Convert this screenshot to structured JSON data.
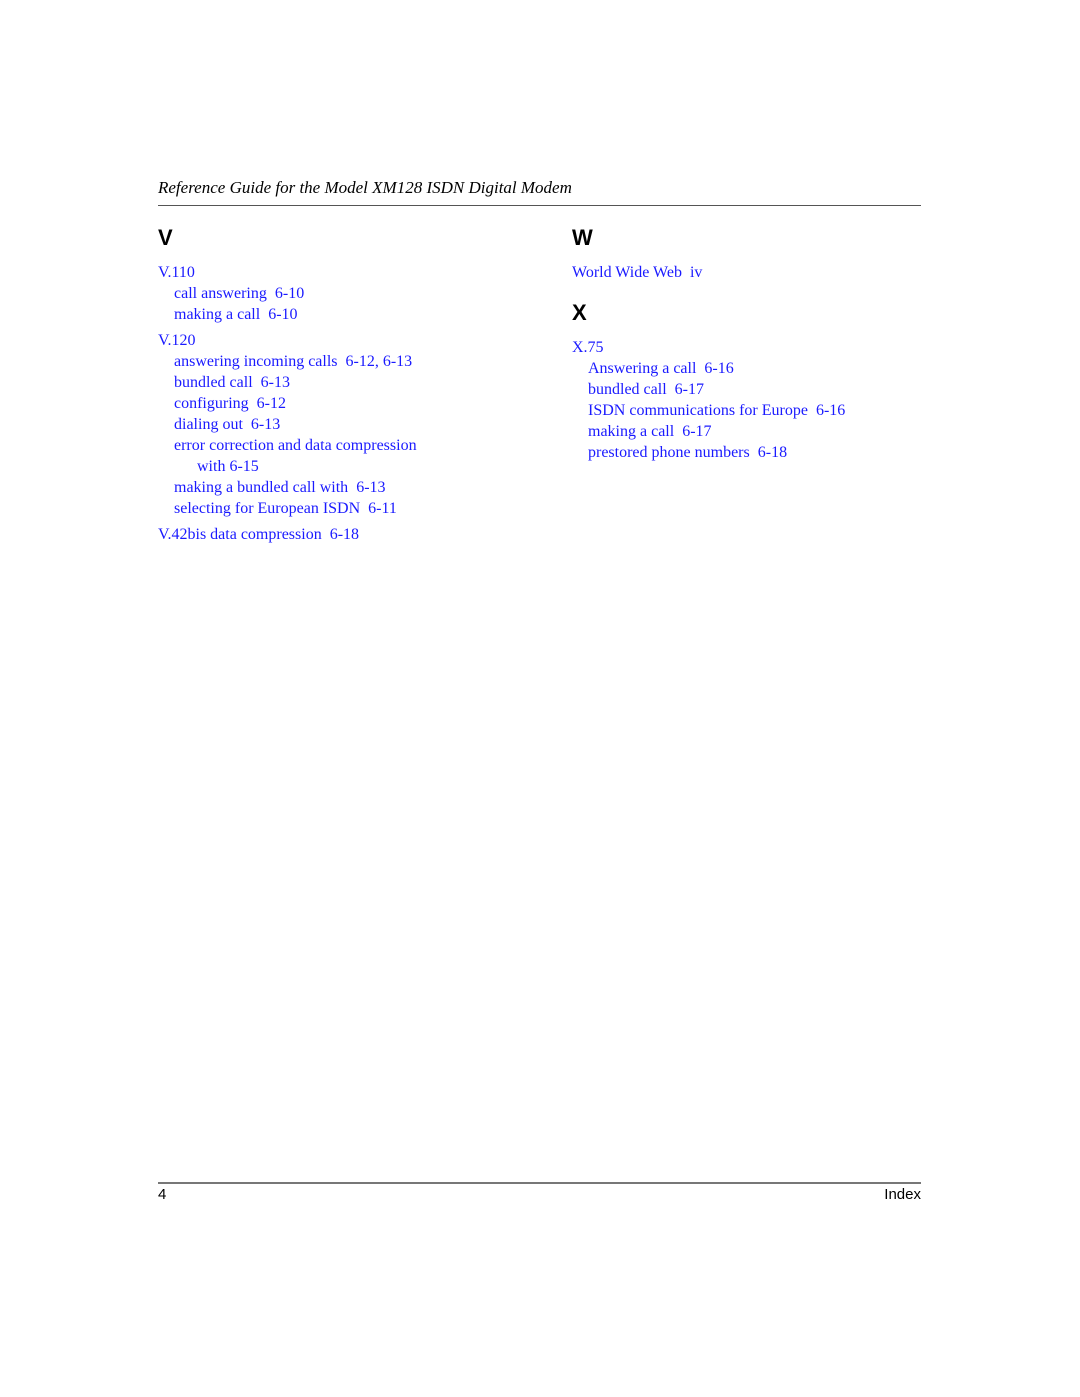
{
  "header": {
    "title": "Reference Guide for the Model XM128 ISDN Digital Modem"
  },
  "index": {
    "left": {
      "letter": "V",
      "entries": [
        {
          "term": "V.110",
          "page": ""
        },
        {
          "term": "call answering",
          "page": "6-10"
        },
        {
          "term": "making a call",
          "page": "6-10"
        },
        {
          "term": "V.120",
          "page": ""
        },
        {
          "term": "answering incoming calls",
          "page": "6-12, 6-13"
        },
        {
          "term": "bundled call",
          "page": "6-13"
        },
        {
          "term": "configuring",
          "page": "6-12"
        },
        {
          "term": "dialing out",
          "page": "6-13"
        },
        {
          "term": "error correction and data compression",
          "page": ""
        },
        {
          "term": "with",
          "page": "6-15"
        },
        {
          "term": "making a bundled call with",
          "page": "6-13"
        },
        {
          "term": "selecting for European ISDN",
          "page": "6-11"
        },
        {
          "term": "V.42bis data compression",
          "page": "6-18"
        }
      ]
    },
    "right_w": {
      "letter": "W",
      "entries": [
        {
          "term": "World Wide Web",
          "page": "iv"
        }
      ]
    },
    "right_x": {
      "letter": "X",
      "entries": [
        {
          "term": "X.75",
          "page": ""
        },
        {
          "term": "Answering a call",
          "page": "6-16"
        },
        {
          "term": "bundled call",
          "page": "6-17"
        },
        {
          "term": "ISDN communications for Europe",
          "page": "6-16"
        },
        {
          "term": "making a call",
          "page": "6-17"
        },
        {
          "term": "prestored phone numbers",
          "page": "6-18"
        }
      ]
    }
  },
  "footer": {
    "page_number": "4",
    "section": "Index"
  },
  "colors": {
    "link": "#1a1aff",
    "text": "#000000"
  }
}
